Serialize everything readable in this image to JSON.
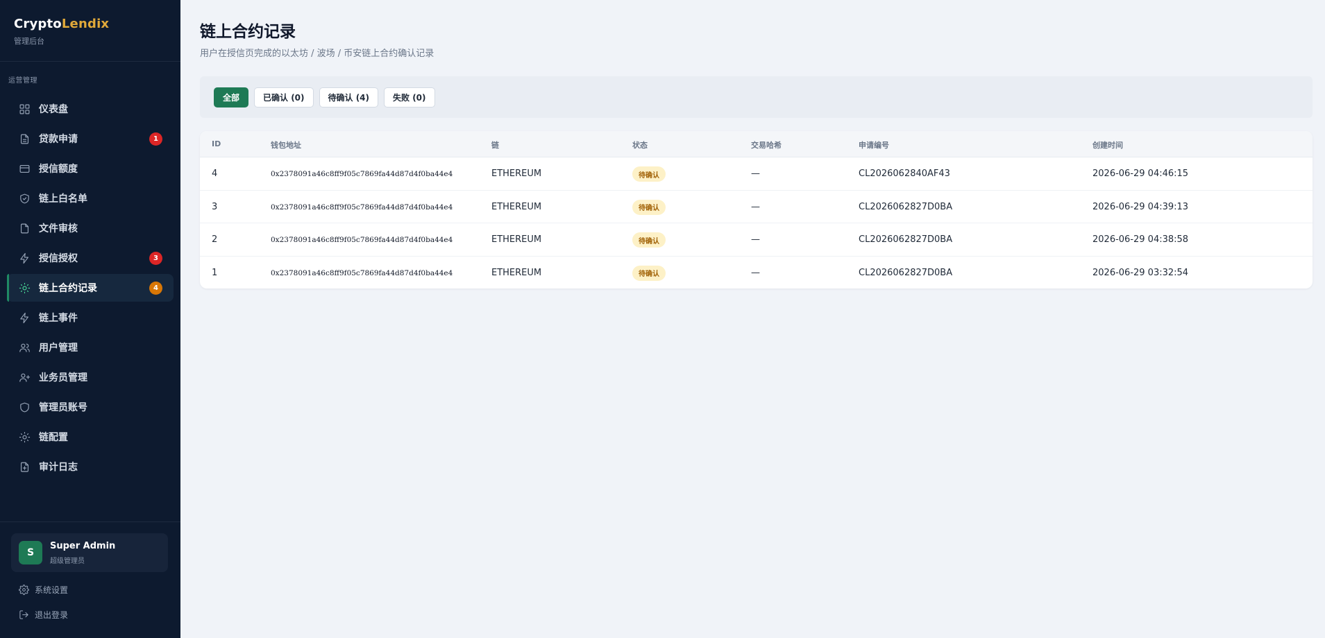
{
  "brand": {
    "name_part1": "Crypto",
    "name_part2": "Lendix",
    "subtitle": "管理后台"
  },
  "sidebar": {
    "section_label": "运营管理",
    "items": [
      {
        "label": "仪表盘",
        "icon": "grid-icon",
        "badge": ""
      },
      {
        "label": "贷款申请",
        "icon": "document-icon",
        "badge": "1"
      },
      {
        "label": "授信额度",
        "icon": "card-icon",
        "badge": ""
      },
      {
        "label": "链上白名单",
        "icon": "shield-check-icon",
        "badge": ""
      },
      {
        "label": "文件审核",
        "icon": "file-icon",
        "badge": ""
      },
      {
        "label": "授信授权",
        "icon": "bolt-icon",
        "badge": "3"
      },
      {
        "label": "链上合约记录",
        "icon": "sun-icon",
        "badge": "4",
        "active": true
      },
      {
        "label": "链上事件",
        "icon": "bolt-icon",
        "badge": ""
      },
      {
        "label": "用户管理",
        "icon": "users-icon",
        "badge": ""
      },
      {
        "label": "业务员管理",
        "icon": "user-plus-icon",
        "badge": ""
      },
      {
        "label": "管理员账号",
        "icon": "shield-icon",
        "badge": ""
      },
      {
        "label": "链配置",
        "icon": "sun-icon",
        "badge": ""
      },
      {
        "label": "审计日志",
        "icon": "file-plus-icon",
        "badge": ""
      }
    ],
    "user": {
      "avatar": "S",
      "name": "Super Admin",
      "role": "超级管理员"
    },
    "settings_label": "系统设置",
    "logout_label": "退出登录"
  },
  "page": {
    "title": "链上合约记录",
    "subtitle": "用户在授信页完成的以太坊 / 波场 / 币安链上合约确认记录"
  },
  "filters": [
    {
      "label": "全部",
      "active": true
    },
    {
      "label": "已确认 (0)",
      "active": false
    },
    {
      "label": "待确认 (4)",
      "active": false
    },
    {
      "label": "失败 (0)",
      "active": false
    }
  ],
  "table": {
    "headers": {
      "id": "ID",
      "wallet": "钱包地址",
      "chain": "链",
      "status": "状态",
      "tx_hash": "交易哈希",
      "app_no": "申请编号",
      "created": "创建时间"
    },
    "rows": [
      {
        "id": "4",
        "wallet": "0x2378091a46c8ff9f05c7869fa44d87d4f0ba44e4",
        "chain": "ETHEREUM",
        "status": "待确认",
        "tx_hash": "—",
        "app_no": "CL2026062840AF43",
        "created": "2026-06-29 04:46:15"
      },
      {
        "id": "3",
        "wallet": "0x2378091a46c8ff9f05c7869fa44d87d4f0ba44e4",
        "chain": "ETHEREUM",
        "status": "待确认",
        "tx_hash": "—",
        "app_no": "CL2026062827D0BA",
        "created": "2026-06-29 04:39:13"
      },
      {
        "id": "2",
        "wallet": "0x2378091a46c8ff9f05c7869fa44d87d4f0ba44e4",
        "chain": "ETHEREUM",
        "status": "待确认",
        "tx_hash": "—",
        "app_no": "CL2026062827D0BA",
        "created": "2026-06-29 04:38:58"
      },
      {
        "id": "1",
        "wallet": "0x2378091a46c8ff9f05c7869fa44d87d4f0ba44e4",
        "chain": "ETHEREUM",
        "status": "待确认",
        "tx_hash": "—",
        "app_no": "CL2026062827D0BA",
        "created": "2026-06-29 03:32:54"
      }
    ]
  },
  "colors": {
    "accent": "#1e7a55",
    "sidebar_bg": "#0d1a2f",
    "brand_accent": "#e0a93a",
    "badge_red": "#dc2626",
    "badge_orange": "#d97706",
    "pending_bg": "#fdf1c7",
    "pending_text": "#a16207"
  }
}
